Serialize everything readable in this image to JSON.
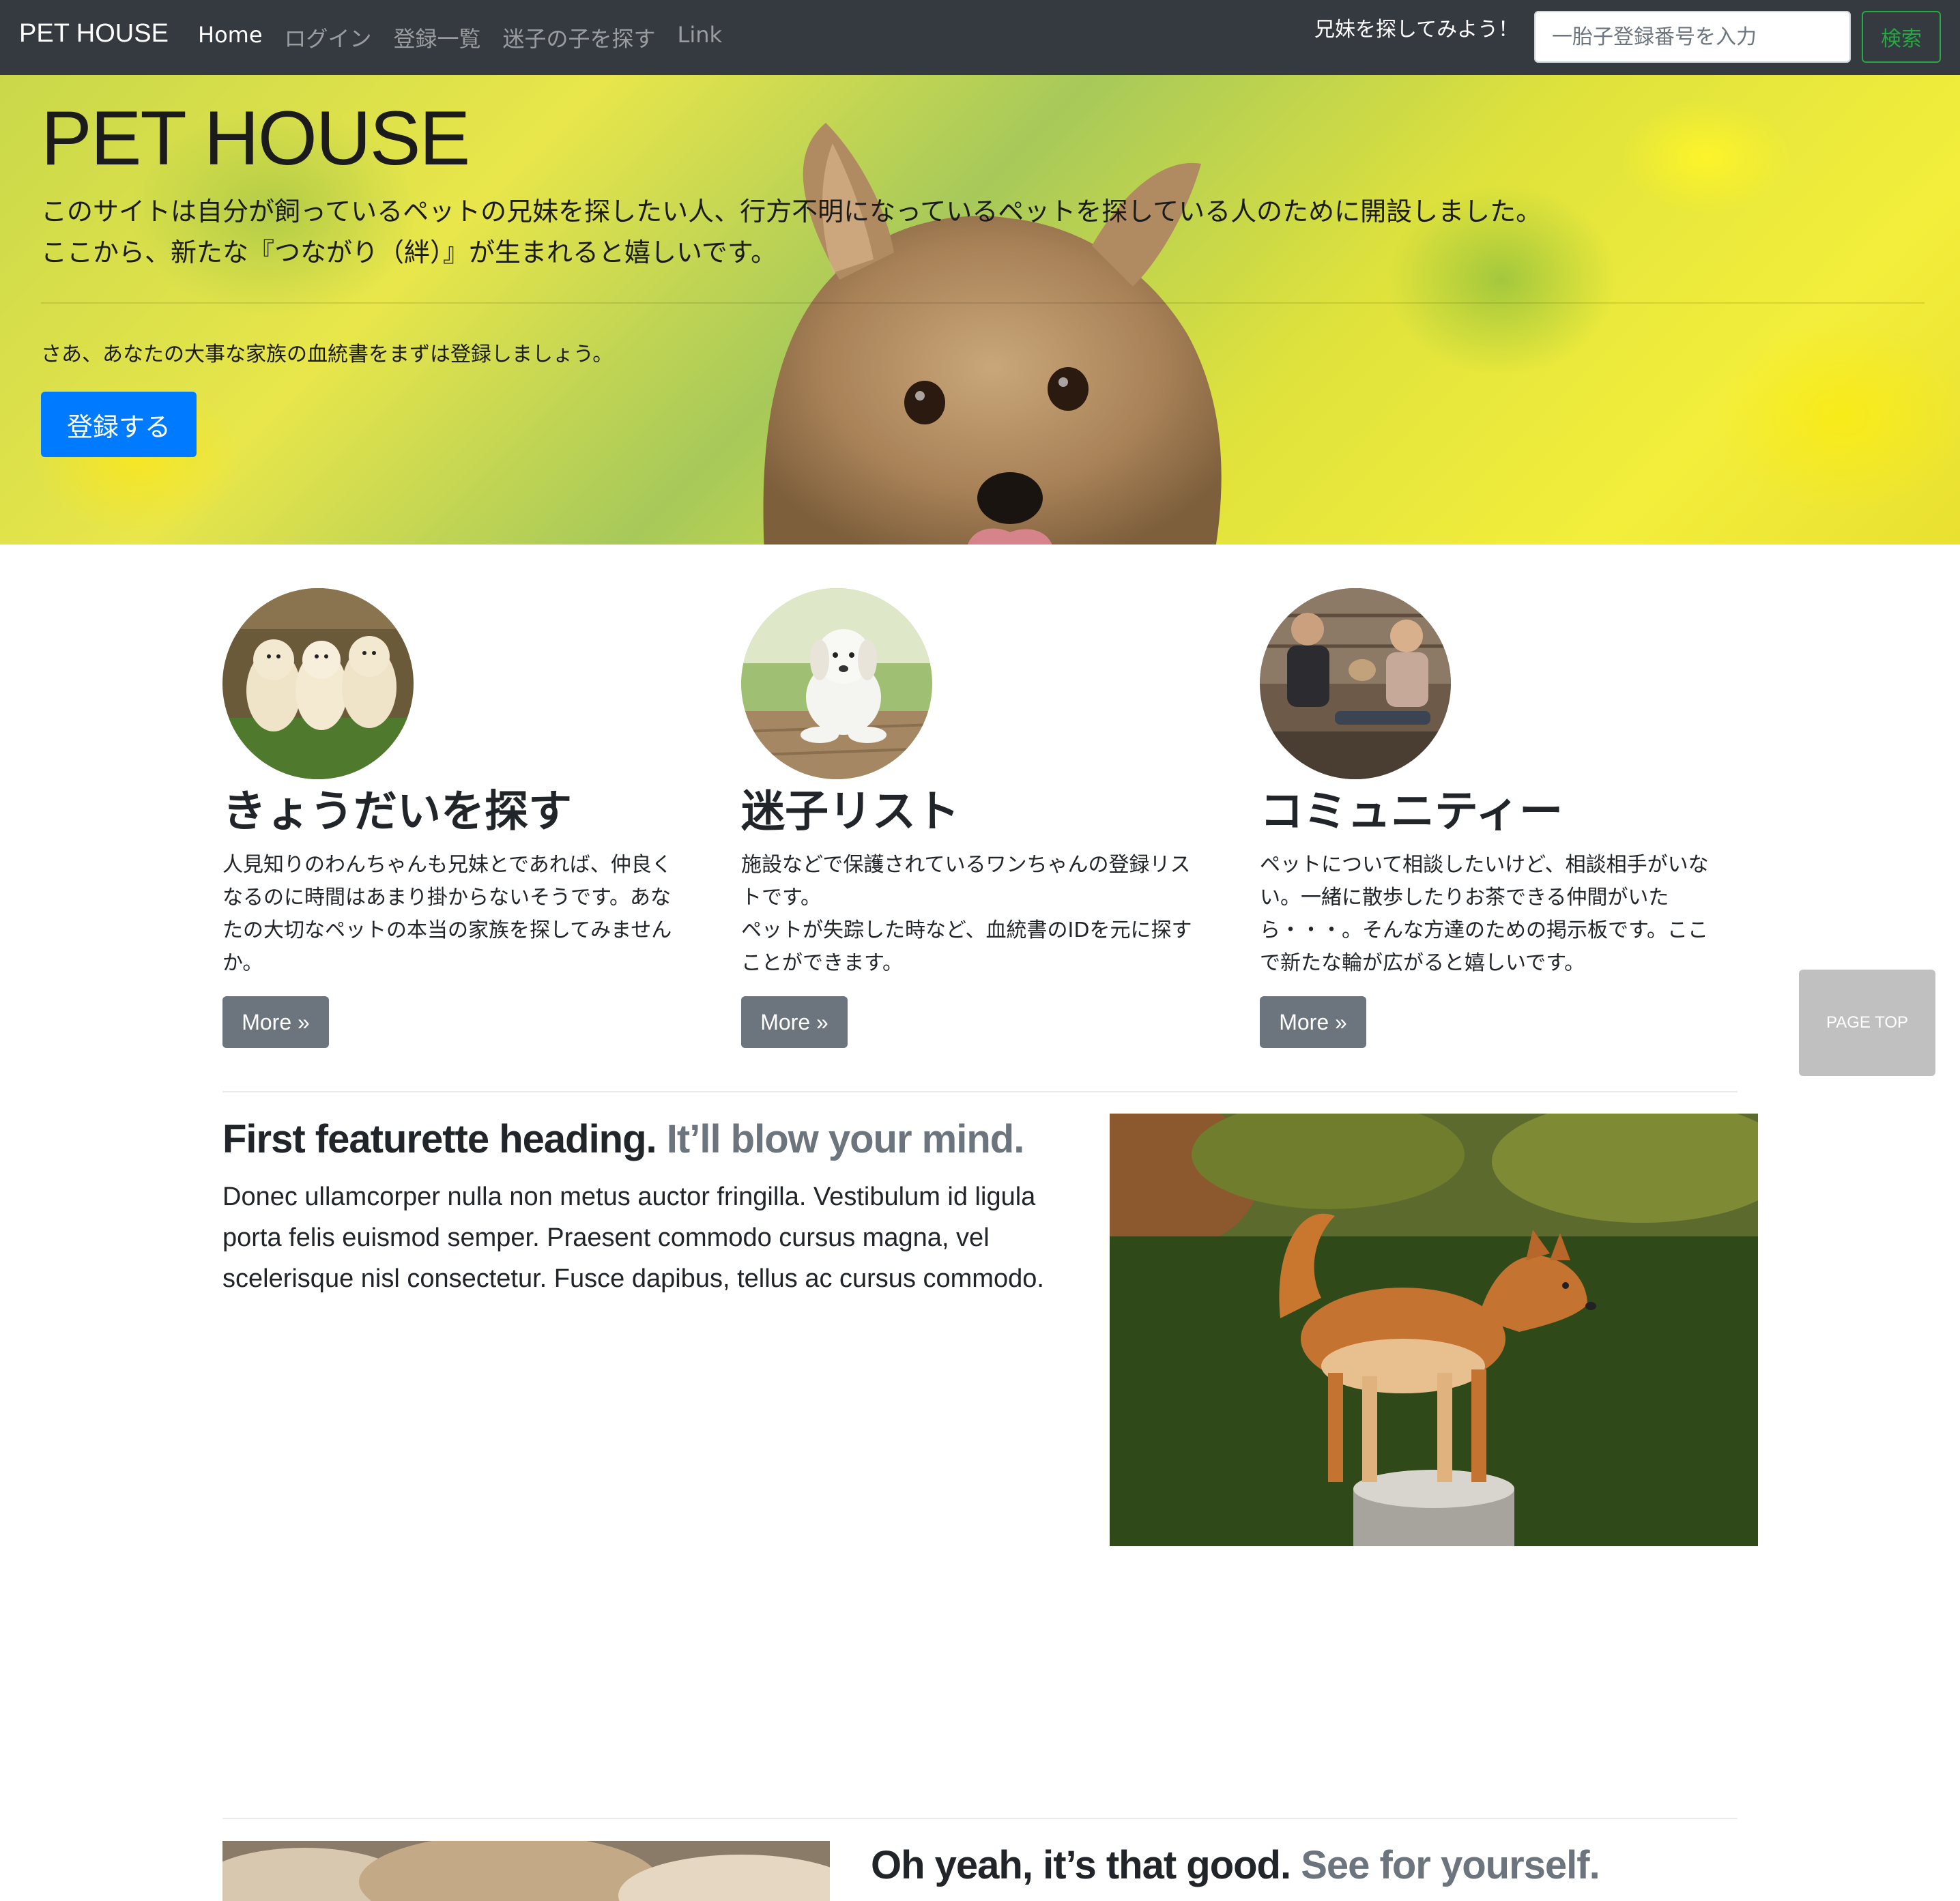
{
  "navbar": {
    "brand": "PET HOUSE",
    "links": [
      {
        "label": "Home",
        "active": true
      },
      {
        "label": "ログイン",
        "active": false
      },
      {
        "label": "登録一覧",
        "active": false
      },
      {
        "label": "迷子の子を探す",
        "active": false
      },
      {
        "label": "Link",
        "active": false
      }
    ],
    "prompt": "兄妹を探してみよう！",
    "search_placeholder": "一胎子登録番号を入力",
    "search_button": "検索"
  },
  "hero": {
    "title": "PET HOUSE",
    "lead_line1": "このサイトは自分が飼っているペットの兄妹を探したい人、行方不明になっているペットを探している人のために開設しました。",
    "lead_line2": "ここから、新たな『つながり（絆）』が生まれると嬉しいです。",
    "note": "さあ、あなたの大事な家族の血統書をまずは登録しましょう。",
    "button": "登録する"
  },
  "columns": [
    {
      "title": "きょうだいを探す",
      "text": "人見知りのわんちゃんも兄妹とであれば、仲良くなるのに時間はあまり掛からないそうです。あなたの大切なペットの本当の家族を探してみませんか。",
      "button": "More »",
      "image": "three-puppies-photo"
    },
    {
      "title": "迷子リスト",
      "text_line1": "施設などで保護されているワンちゃんの登録リストです。",
      "text_line2": "ペットが失踪した時など、血統書のIDを元に探すことができます。",
      "button": "More »",
      "image": "white-puppy-photo"
    },
    {
      "title": "コミュニティー",
      "text": "ペットについて相談したいけど、相談相手がいない。一緒に散歩したりお茶できる仲間がいたら・・・。そんな方達のための掲示板です。ここで新たな輪が広がると嬉しいです。",
      "button": "More »",
      "image": "friends-with-dog-photo"
    }
  ],
  "featurette1": {
    "heading": "First featurette heading.",
    "heading_muted": "It’ll blow your mind.",
    "text": "Donec ullamcorper nulla non metus auctor fringilla. Vestibulum id ligula porta felis euismod semper. Praesent commodo cursus magna, vel scelerisque nisl consectetur. Fusce dapibus, tellus ac cursus commodo.",
    "image": "shiba-dog-photo"
  },
  "featurette2": {
    "heading": "Oh yeah, it’s that good.",
    "heading_muted": "See for yourself.",
    "image": "cat-photo"
  },
  "page_top": "PAGE TOP",
  "colors": {
    "navbar": "#343a40",
    "primary": "#007bff",
    "success": "#28a745",
    "secondary": "#6c757d"
  }
}
